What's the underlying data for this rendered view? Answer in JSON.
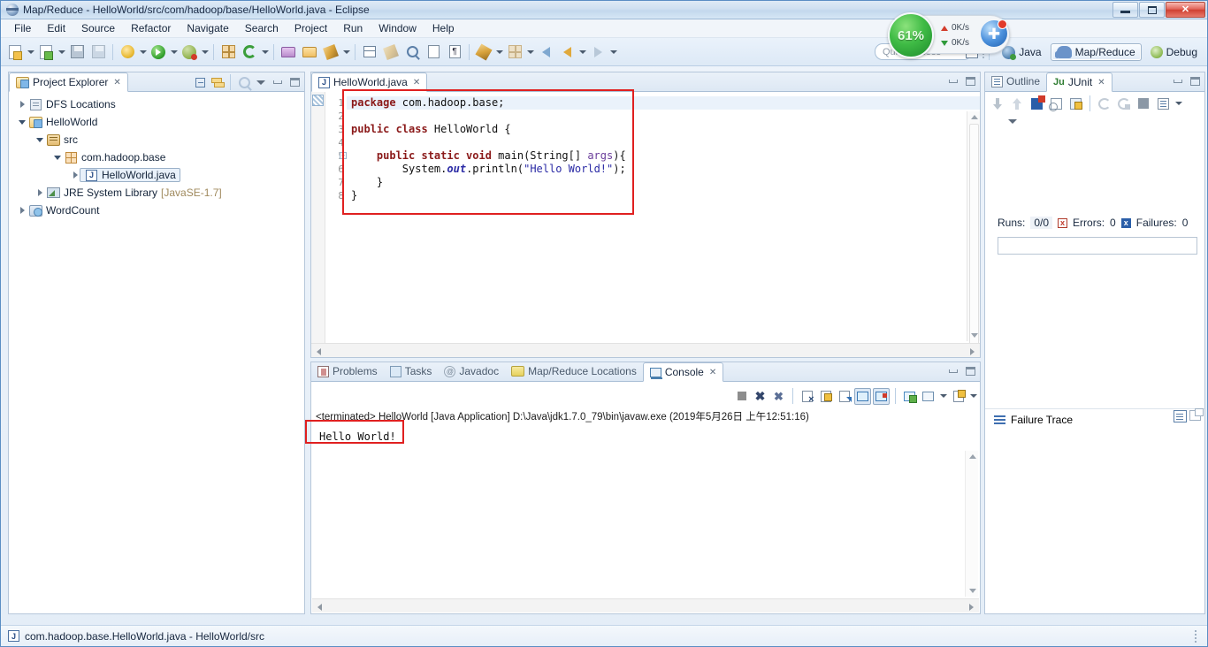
{
  "window": {
    "title": "Map/Reduce - HelloWorld/src/com/hadoop/base/HelloWorld.java - Eclipse",
    "app_icon": "eclipse-icon",
    "controls": {
      "minimize": "minimize-button",
      "maximize": "maximize-button",
      "close": "✕"
    }
  },
  "menubar": {
    "items": [
      {
        "label": "File"
      },
      {
        "label": "Edit"
      },
      {
        "label": "Source"
      },
      {
        "label": "Refactor"
      },
      {
        "label": "Navigate"
      },
      {
        "label": "Search"
      },
      {
        "label": "Project"
      },
      {
        "label": "Run"
      },
      {
        "label": "Window"
      },
      {
        "label": "Help"
      }
    ]
  },
  "toolbar": {
    "groups": [
      [
        "new-wizard-icon",
        "dropdown",
        "new-java-package-icon",
        "dropdown",
        "save-icon",
        "save-all-icon"
      ],
      [
        "external-tools-icon",
        "dropdown",
        "run-icon",
        "dropdown",
        "debug-icon",
        "dropdown"
      ],
      [
        "new-java-package2-icon",
        "refresh-icon",
        "dropdown"
      ],
      [
        "open-type-icon",
        "open-folder-icon",
        "search-icon",
        "dropdown"
      ],
      [
        "toggle-mark-occurrences-icon",
        "pencil-icon"
      ],
      [
        "last-edit-location-icon",
        "show-whitespace-icon",
        "block-selection-icon"
      ],
      [
        "next-annotation-icon",
        "dropdown",
        "previous-annotation-icon",
        "dropdown"
      ],
      [
        "back-icon",
        "forward-icon",
        "dropdown",
        "forward2-icon",
        "dropdown"
      ]
    ]
  },
  "quick_access": {
    "placeholder": "Quick Access",
    "value": ""
  },
  "perspectives": {
    "open_perspective_icon": "open-perspective-icon",
    "items": [
      {
        "label": "Java",
        "icon": "java-perspective-icon",
        "active": false
      },
      {
        "label": "Map/Reduce",
        "icon": "elephant-icon",
        "active": true
      },
      {
        "label": "Debug",
        "icon": "debug-perspective-icon",
        "active": false
      }
    ]
  },
  "system_monitor": {
    "cpu_percent": "61%",
    "upload_rate": "0K/s",
    "download_rate": "0K/s",
    "badge_icon": "network-badge-icon"
  },
  "project_explorer": {
    "tab_label": "Project Explorer",
    "tab_close": "✕",
    "tools": [
      "collapse-all-icon",
      "link-with-editor-icon",
      "focus-icon",
      "view-menu-icon",
      "minimize-icon",
      "maximize-icon"
    ],
    "tree": [
      {
        "label": "DFS Locations",
        "icon": "dfs-locations-icon",
        "indent": 0,
        "twisty": "closed",
        "selected": false,
        "note": ""
      },
      {
        "label": "HelloWorld",
        "icon": "java-project-icon",
        "indent": 0,
        "twisty": "open",
        "selected": false,
        "note": ""
      },
      {
        "label": "src",
        "icon": "source-folder-icon",
        "indent": 1,
        "twisty": "open",
        "selected": false,
        "note": ""
      },
      {
        "label": "com.hadoop.base",
        "icon": "package-icon",
        "indent": 2,
        "twisty": "open",
        "selected": false,
        "note": ""
      },
      {
        "label": "HelloWorld.java",
        "icon": "java-file-icon",
        "indent": 3,
        "twisty": "closed",
        "selected": true,
        "note": ""
      },
      {
        "label": "JRE System Library",
        "icon": "library-icon",
        "indent": 1,
        "twisty": "closed",
        "selected": false,
        "note": "[JavaSE-1.7]"
      },
      {
        "label": "WordCount",
        "icon": "project-icon",
        "indent": 0,
        "twisty": "closed",
        "selected": false,
        "note": ""
      }
    ]
  },
  "editor": {
    "tab_label": "HelloWorld.java",
    "tab_icon": "java-file-icon",
    "tab_close": "✕",
    "tools": [
      "minimize-icon",
      "maximize-icon"
    ],
    "line_numbers": [
      "1",
      "2",
      "3",
      "4",
      "5",
      "6",
      "7",
      "8"
    ],
    "fold_line": "5",
    "lines": [
      {
        "n": 1,
        "current": true,
        "tokens": [
          {
            "t": "package",
            "c": "kw"
          },
          {
            "t": " com.hadoop.base;",
            "c": ""
          }
        ]
      },
      {
        "n": 2,
        "current": false,
        "tokens": [
          {
            "t": "",
            "c": ""
          }
        ]
      },
      {
        "n": 3,
        "current": false,
        "tokens": [
          {
            "t": "public class",
            "c": "kw"
          },
          {
            "t": " HelloWorld {",
            "c": ""
          }
        ]
      },
      {
        "n": 4,
        "current": false,
        "tokens": [
          {
            "t": "",
            "c": ""
          }
        ]
      },
      {
        "n": 5,
        "current": false,
        "tokens": [
          {
            "t": "    ",
            "c": ""
          },
          {
            "t": "public static void",
            "c": "kw"
          },
          {
            "t": " main(String[] ",
            "c": ""
          },
          {
            "t": "args",
            "c": "par"
          },
          {
            "t": "){",
            "c": ""
          }
        ]
      },
      {
        "n": 6,
        "current": false,
        "tokens": [
          {
            "t": "        System.",
            "c": ""
          },
          {
            "t": "out",
            "c": "fld"
          },
          {
            "t": ".println(",
            "c": ""
          },
          {
            "t": "\"Hello World!\"",
            "c": "str"
          },
          {
            "t": ");",
            "c": ""
          }
        ]
      },
      {
        "n": 7,
        "current": false,
        "tokens": [
          {
            "t": "    }",
            "c": ""
          }
        ]
      },
      {
        "n": 8,
        "current": false,
        "tokens": [
          {
            "t": "}",
            "c": ""
          }
        ]
      }
    ]
  },
  "bottom_panel": {
    "tabs": [
      {
        "label": "Problems",
        "icon": "problems-icon",
        "active": false
      },
      {
        "label": "Tasks",
        "icon": "tasks-icon",
        "active": false
      },
      {
        "label": "Javadoc",
        "icon": "javadoc-icon",
        "active": false
      },
      {
        "label": "Map/Reduce Locations",
        "icon": "mapreduce-locations-icon",
        "active": false
      },
      {
        "label": "Console",
        "icon": "console-icon",
        "active": true
      }
    ],
    "tab_close": "✕",
    "tools": [
      "terminate-icon",
      "remove-launch-icon",
      "remove-all-launches-icon",
      "clear-console-icon",
      "scroll-lock-icon",
      "word-wrap-icon",
      "show-console-on-output-icon",
      "show-console-on-error-icon",
      "pin-console-icon",
      "display-selected-console-icon",
      "open-console-icon"
    ],
    "window_tools": [
      "minimize-icon",
      "maximize-icon"
    ],
    "console": {
      "header": "<terminated> HelloWorld [Java Application] D:\\Java\\jdk1.7.0_79\\bin\\javaw.exe (2019年5月26日 上午12:51:16)",
      "output": "Hello World!"
    }
  },
  "right_panel": {
    "tabs": [
      {
        "label": "Outline",
        "icon": "outline-icon",
        "active": false
      },
      {
        "label": "JUnit",
        "icon": "junit-icon",
        "active": true
      }
    ],
    "tab_close": "✕",
    "window_tools": [
      "minimize-icon",
      "maximize-icon"
    ],
    "toolbar": [
      "next-failed-icon",
      "previous-failed-icon",
      "show-failures-only-icon",
      "stop-junit-icon",
      "lock-scroll-icon",
      "rerun-test-icon",
      "rerun-failed-icon",
      "stop-icon",
      "test-history-icon",
      "view-menu-icon"
    ],
    "second_row": [
      "collapse-icon"
    ],
    "stats": {
      "runs_label": "Runs:",
      "runs_value": "0/0",
      "errors_label": "Errors:",
      "errors_value": "0",
      "errors_badge": "x",
      "failures_label": "Failures:",
      "failures_value": "0",
      "failures_badge": "x"
    },
    "failure_trace": {
      "label": "Failure Trace",
      "icon": "hamburger-icon",
      "tools": [
        "filter-stack-trace-icon",
        "maximize-icon"
      ]
    }
  },
  "statusbar": {
    "icon": "java-file-icon",
    "text": "com.hadoop.base.HelloWorld.java - HelloWorld/src"
  },
  "annotations": {
    "highlight_color": "#e02020",
    "boxes": [
      "code-region-highlight",
      "console-output-highlight"
    ]
  },
  "colors": {
    "keyword": "#8b1a1a",
    "string": "#2a2aa5",
    "field": "#2a2aa5",
    "parameter": "#6a3d9a",
    "accent": "#e02020",
    "titlebar": "#cfe0f1"
  }
}
